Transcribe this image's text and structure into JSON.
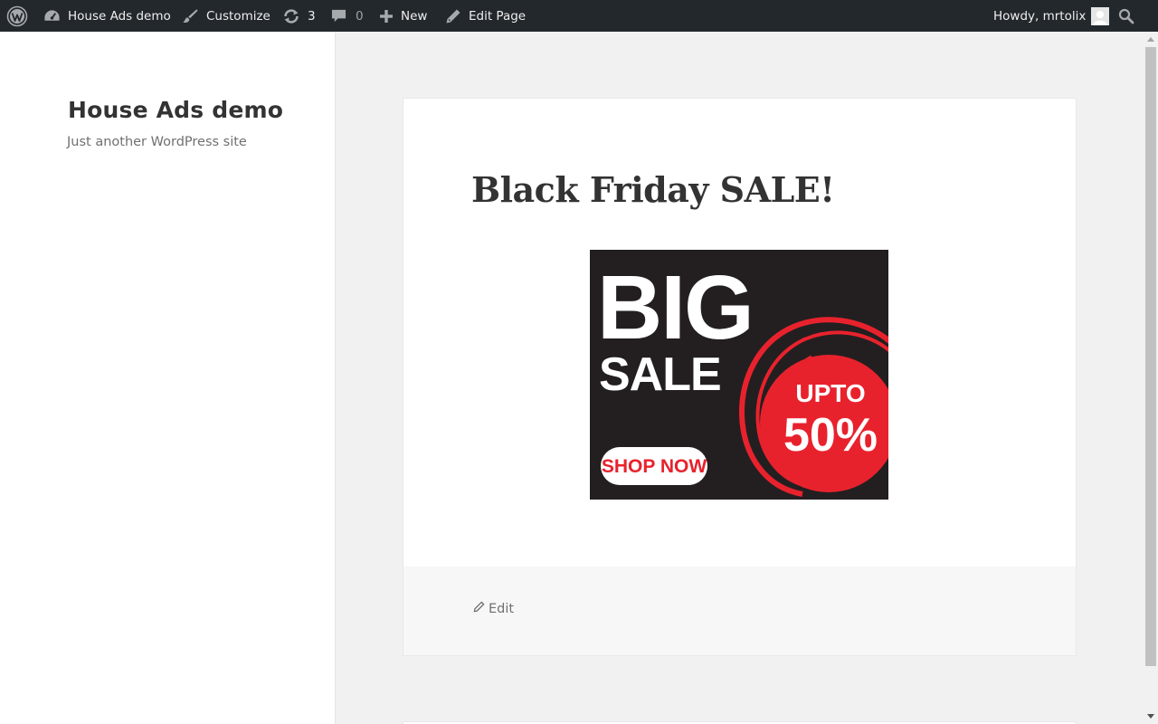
{
  "adminbar": {
    "site_name": "House Ads demo",
    "customize": "Customize",
    "updates_count": "3",
    "comments_count": "0",
    "new_label": "New",
    "edit_page": "Edit Page",
    "howdy": "Howdy, mrtolix"
  },
  "site": {
    "title": "House Ads demo",
    "description": "Just another WordPress site"
  },
  "post": {
    "title": "Black Friday SALE!",
    "edit_label": "Edit"
  },
  "ad": {
    "line1": "BIG",
    "line2": "SALE",
    "circle_top": "UPTO",
    "circle_bottom": "50%",
    "cta": "SHOP NOW"
  },
  "colors": {
    "adminbar_bg": "#23282d",
    "ad_bg": "#231f20",
    "ad_red": "#e8222d"
  }
}
